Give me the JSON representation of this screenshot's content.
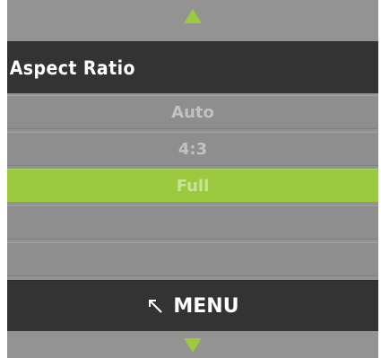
{
  "menu": {
    "title": "Aspect Ratio",
    "options": [
      {
        "label": "Auto",
        "selected": false
      },
      {
        "label": "4:3",
        "selected": false
      },
      {
        "label": "Full",
        "selected": true
      },
      {
        "label": "",
        "selected": false
      },
      {
        "label": "",
        "selected": false
      }
    ],
    "back_label": "MENU",
    "scroll_up_icon": "triangle-up-icon",
    "scroll_down_icon": "triangle-down-icon",
    "back_icon": "arrow-up-left-icon"
  },
  "colors": {
    "panel": "#939393",
    "dark_bar": "#333333",
    "accent": "#9bca3e",
    "option_text": "#c2c2c2"
  }
}
